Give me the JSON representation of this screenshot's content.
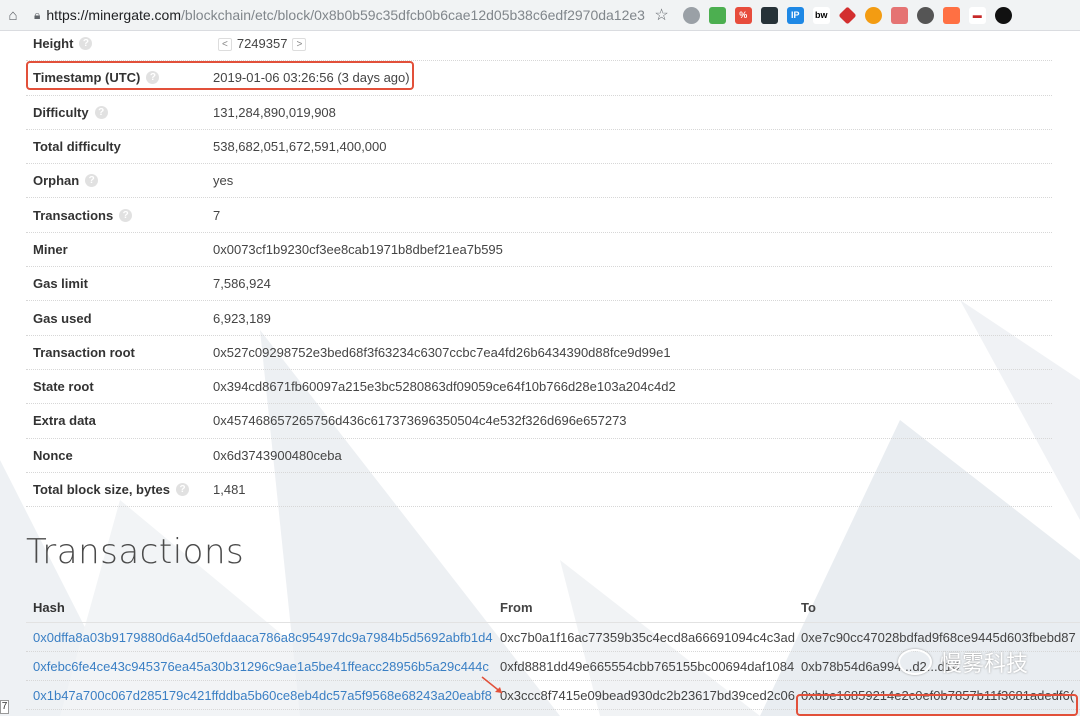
{
  "browser": {
    "url_host": "https://minergate.com",
    "url_path": "/blockchain/etc/block/0x8b0b59c35dfcb0b6cae12d05b38c6edf2970da12e3..."
  },
  "block": {
    "rows": [
      {
        "label": "Height",
        "value": "7249357",
        "help": true,
        "nav": true
      },
      {
        "label": "Timestamp (UTC)",
        "value": "2019-01-06 03:26:56 (3 days ago)",
        "help": true
      },
      {
        "label": "Difficulty",
        "value": "131,284,890,019,908",
        "help": true
      },
      {
        "label": "Total difficulty",
        "value": "538,682,051,672,591,400,000",
        "help": false
      },
      {
        "label": "Orphan",
        "value": "yes",
        "help": true
      },
      {
        "label": "Transactions",
        "value": "7",
        "help": true
      },
      {
        "label": "Miner",
        "value": "0x0073cf1b9230cf3ee8cab1971b8dbef21ea7b595",
        "help": false
      },
      {
        "label": "Gas limit",
        "value": "7,586,924",
        "help": false
      },
      {
        "label": "Gas used",
        "value": "6,923,189",
        "help": false
      },
      {
        "label": "Transaction root",
        "value": "0x527c09298752e3bed68f3f63234c6307ccbc7ea4fd26b6434390d88fce9d99e1",
        "help": false
      },
      {
        "label": "State root",
        "value": "0x394cd8671fb60097a215e3bc5280863df09059ce64f10b766d28e103a204c4d2",
        "help": false
      },
      {
        "label": "Extra data",
        "value": "0x457468657265756d436c617373696350504c4e532f326d696e657273",
        "help": false
      },
      {
        "label": "Nonce",
        "value": "0x6d3743900480ceba",
        "help": false
      },
      {
        "label": "Total block size, bytes",
        "value": "1,481",
        "help": true
      }
    ]
  },
  "transactions": {
    "title": "Transactions",
    "headers": {
      "hash": "Hash",
      "from": "From",
      "to": "To"
    },
    "rows": [
      {
        "hash": "0x0dffa8a03b9179880d6a4d50efdaaca786a8c95497dc9a7984b5d5692abfb1d4",
        "from": "0xc7b0a1f16ac77359b35c4ecd8a66691094c4c3ad",
        "to": "0xe7c90cc47028bdfad9f68ce9445d603fbebd87"
      },
      {
        "hash": "0xfebc6fe4ce43c945376ea45a30b31296c9ae1a5be41ffeacc28956b5a29c444c",
        "from": "0xfd8881dd49e665554cbb765155bc00694daf1084",
        "to": "0xb78b54d6a994...d2...d14"
      },
      {
        "hash": "0x1b47a700c067d285179c421ffddba5b60ce8eb4dc57a5f9568e68243a20eabf8",
        "from": "0x3ccc8f7415e09bead930dc2b23617bd39ced2c06",
        "to": "0xbbe16859214e2c0ef0b7857b11f3681adedf6("
      }
    ]
  },
  "watermark": "慢雾科技",
  "row_marker": "7",
  "colors": {
    "link": "#3a7fc4",
    "highlight": "#e2503a",
    "bg_art": "#eef1f4"
  }
}
